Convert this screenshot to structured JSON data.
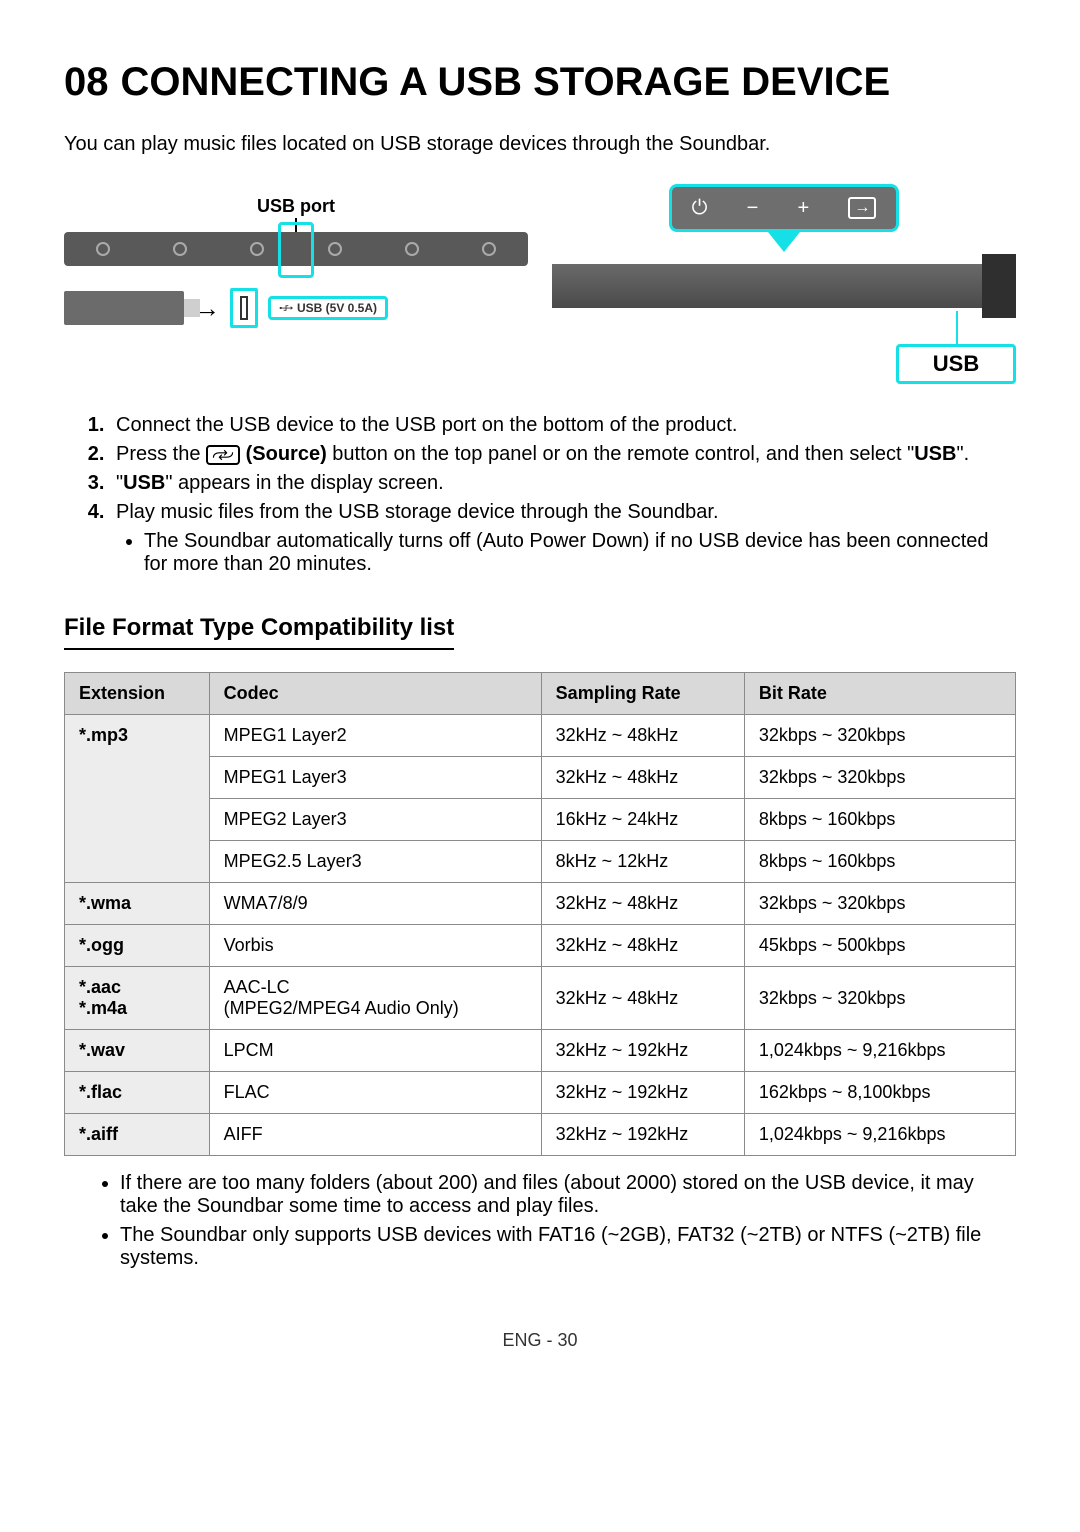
{
  "section": {
    "number": "08",
    "title": "CONNECTING A USB STORAGE DEVICE"
  },
  "intro": "You can play music files located on USB storage devices through the Soundbar.",
  "diagram": {
    "usb_port_label": "USB port",
    "usb_port_spec": "USB (5V 0.5A)",
    "display_text": "USB"
  },
  "steps": [
    {
      "text": "Connect the USB device to the USB port on the bottom of the product."
    },
    {
      "prefix": "Press the ",
      "bold1": "(Source)",
      "middle": " button on the top panel or on the remote control, and then select \"",
      "bold2": "USB",
      "suffix": "\"."
    },
    {
      "prefix": "\"",
      "bold1": "USB",
      "suffix": "\" appears in the display screen."
    },
    {
      "text": "Play music files from the USB storage device through the Soundbar.",
      "sub": [
        "The Soundbar automatically turns off (Auto Power Down) if no USB device has been connected for more than 20 minutes."
      ]
    }
  ],
  "subheading": "File Format Type Compatibility list",
  "table": {
    "headers": [
      "Extension",
      "Codec",
      "Sampling Rate",
      "Bit Rate"
    ],
    "rows": [
      {
        "ext": "*.mp3",
        "rowspan": 4,
        "codec": "MPEG1 Layer2",
        "rate": "32kHz ~ 48kHz",
        "bit": "32kbps ~ 320kbps"
      },
      {
        "codec": "MPEG1 Layer3",
        "rate": "32kHz ~ 48kHz",
        "bit": "32kbps ~ 320kbps"
      },
      {
        "codec": "MPEG2 Layer3",
        "rate": "16kHz ~ 24kHz",
        "bit": "8kbps ~ 160kbps"
      },
      {
        "codec": "MPEG2.5 Layer3",
        "rate": "8kHz ~ 12kHz",
        "bit": "8kbps ~ 160kbps"
      },
      {
        "ext": "*.wma",
        "rowspan": 1,
        "codec": "WMA7/8/9",
        "rate": "32kHz ~ 48kHz",
        "bit": "32kbps ~ 320kbps"
      },
      {
        "ext": "*.ogg",
        "rowspan": 1,
        "codec": "Vorbis",
        "rate": "32kHz ~ 48kHz",
        "bit": "45kbps ~ 500kbps"
      },
      {
        "ext": "*.aac\n*.m4a",
        "rowspan": 1,
        "codec": "AAC-LC\n(MPEG2/MPEG4 Audio Only)",
        "rate": "32kHz ~ 48kHz",
        "bit": "32kbps ~ 320kbps"
      },
      {
        "ext": "*.wav",
        "rowspan": 1,
        "codec": "LPCM",
        "rate": "32kHz ~ 192kHz",
        "bit": "1,024kbps ~ 9,216kbps"
      },
      {
        "ext": "*.flac",
        "rowspan": 1,
        "codec": "FLAC",
        "rate": "32kHz ~ 192kHz",
        "bit": "162kbps ~ 8,100kbps"
      },
      {
        "ext": "*.aiff",
        "rowspan": 1,
        "codec": "AIFF",
        "rate": "32kHz ~ 192kHz",
        "bit": "1,024kbps ~ 9,216kbps"
      }
    ]
  },
  "notes": [
    "If there are too many folders (about 200) and files (about 2000) stored on the USB device, it may take the Soundbar some time to access and play files.",
    "The Soundbar only supports USB devices with FAT16 (~2GB), FAT32 (~2TB) or NTFS (~2TB) file systems."
  ],
  "footer": "ENG - 30"
}
